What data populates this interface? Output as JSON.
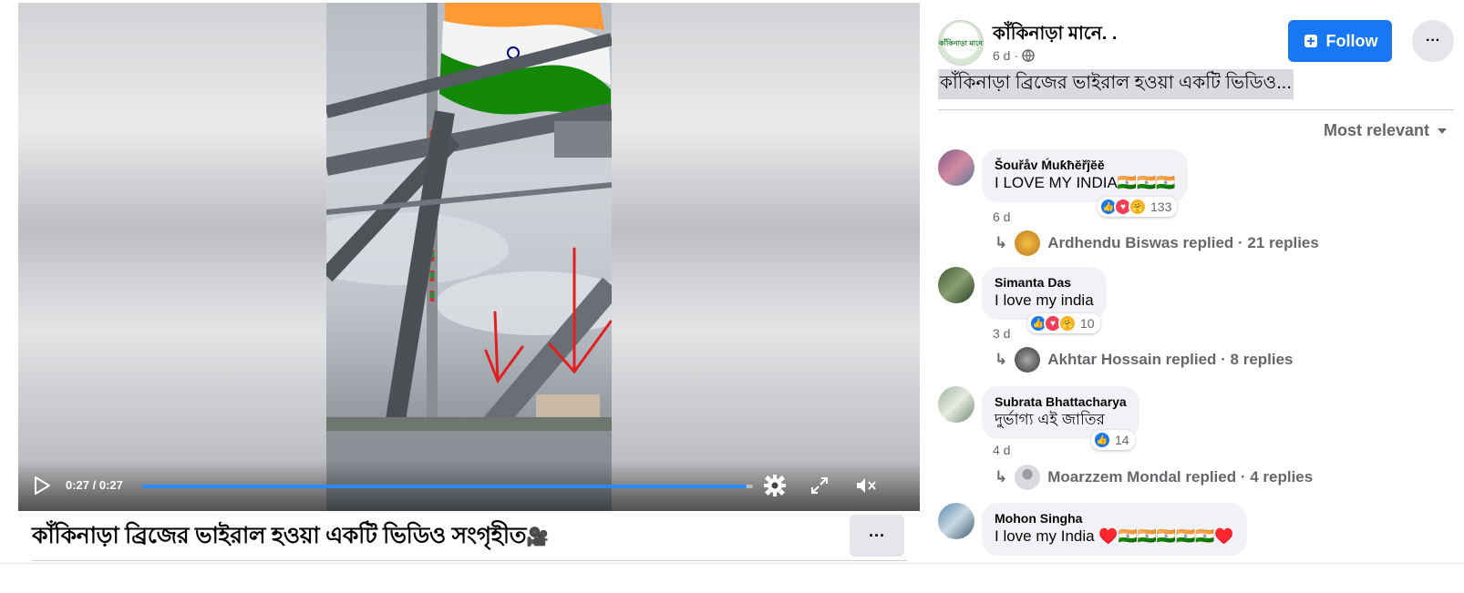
{
  "video": {
    "time_label": "0:27 / 0:27",
    "progress_fraction": 0.99
  },
  "caption": {
    "title": "কাঁকিনাড়া ব্রিজের ভাইরাল হওয়া একটি ভিডিও সংগৃহীত",
    "title_emoji": "🎥",
    "more_label": "···"
  },
  "post": {
    "page_name": "কাঁকিনাড়া মানে. .",
    "avatar_text": "কাঁকিনাড়া মানে",
    "age": "6 d",
    "separator": "·",
    "globe_icon": "globe-icon",
    "follow_label": "Follow",
    "more_label": "···",
    "text": "কাঁকিনাড়া ব্রিজের ভাইরাল হওয়া একটি ভিডিও..."
  },
  "sort": {
    "label": "Most relevant"
  },
  "comments": [
    {
      "author": "Šouřåv Ḿuƙħĕřĵĕĕ",
      "text": "I LOVE MY INDIA🇮🇳🇮🇳🇮🇳",
      "time": "6 d",
      "reactions": [
        "like",
        "love",
        "care"
      ],
      "reaction_count": "133",
      "reply_author": "Ardhendu Biswas",
      "replies_text": "Ardhendu Biswas replied · 21 replies"
    },
    {
      "author": "Simanta Das",
      "text": "I love my india",
      "time": "3 d",
      "reactions": [
        "like",
        "love",
        "care"
      ],
      "reaction_count": "10",
      "reply_author": "Akhtar Hossain",
      "replies_text": "Akhtar Hossain replied · 8 replies"
    },
    {
      "author": "Subrata Bhattacharya",
      "text": "দুর্ভাগ্য এই জাতির",
      "time": "4 d",
      "reactions": [
        "like"
      ],
      "reaction_count": "14",
      "reply_author": "Moarzzem Mondal",
      "replies_text": "Moarzzem Mondal replied · 4 replies"
    },
    {
      "author": "Mohon Singha",
      "text": "I love my India ♥️🇮🇳🇮🇳🇮🇳🇮🇳🇮🇳♥️"
    }
  ],
  "colors": {
    "accent": "#1877f2",
    "progress": "#2d88ff",
    "flag_saffron": "#ff9933",
    "flag_green": "#138808",
    "annotation_red": "#e02020"
  }
}
